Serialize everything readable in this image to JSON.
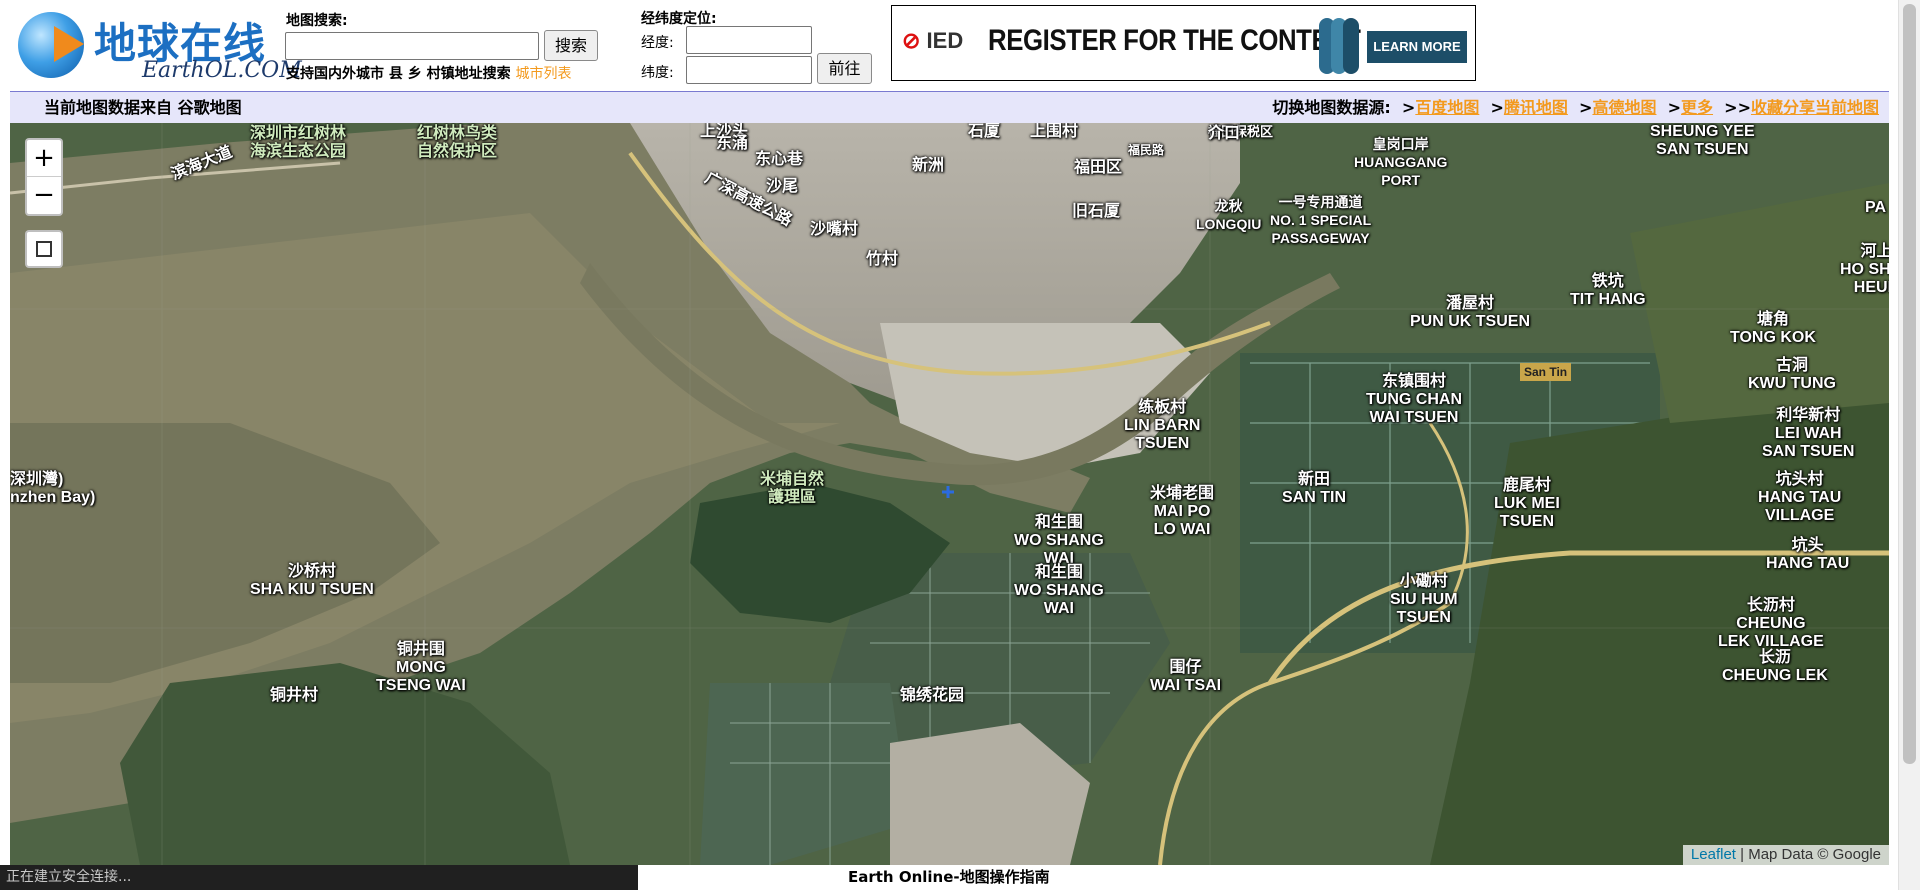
{
  "logo": {
    "cn": "地球在线",
    "en": "EarthOL.COM"
  },
  "search": {
    "label": "地图搜索:",
    "value": "",
    "button": "搜索",
    "hint": "支持国内外城市 县 乡 村镇地址搜索",
    "city_list": "城市列表"
  },
  "coords": {
    "label": "经纬度定位:",
    "lng_label": "经度:",
    "lat_label": "纬度:",
    "lng_value": "",
    "lat_value": "",
    "go_button": "前往"
  },
  "ad": {
    "brand": "IED",
    "headline": "REGISTER FOR THE CONTEST",
    "cta": "LEARN MORE",
    "colors": {
      "brand_mark": "#dd1111",
      "cta_bg": "#1d4e68",
      "logo": "#2c6b8e"
    }
  },
  "bar": {
    "source": "当前地图数据来自 谷歌地图",
    "switch_label": "切换地图数据源:",
    "links": [
      "百度地图",
      "腾讯地图",
      "高德地图",
      "更多"
    ],
    "share": "收藏分享当前地图"
  },
  "map_controls": {
    "zoom_in": "+",
    "zoom_out": "−"
  },
  "map_labels": [
    "深圳市红树林\n海滨生态公园",
    "红树林鸟类\n自然保护区",
    "滨海大道",
    "上沙头",
    "东涌",
    "东心巷",
    "沙尾",
    "新洲",
    "广深高速公路",
    "沙嘴村",
    "竹村",
    "石厦",
    "上围村",
    "福田区",
    "福田保税区",
    "福民路",
    "介口",
    "旧石厦",
    "皇岗口岸\nHUANGGANG\nPORT",
    "龙秋\nLONGQIU",
    "一号专用通道\nNO. 1 SPECIAL\nPASSAGEWAY",
    "SHEUNG YEE\nSAN TSUEN",
    "铁坑\nTIT HANG",
    "河上\nHO SHEU\nHEUN",
    "潘屋村\nPUN UK TSUEN",
    "塘角\nTONG KOK",
    "古洞\nKWU TUNG",
    "东镇围村\nTUNG CHAN\nWAI TSUEN",
    "练板村\nLIN BARN\nTSUEN",
    "利华新村\nLEI WAH\nSAN TSUEN",
    "米埔自然\n護理區",
    "新田\nSAN TIN",
    "米埔老围\nMAI PO\nLO WAI",
    "鹿尾村\nLUK MEI\nTSUEN",
    "坑头村\nHANG TAU\nVILLAGE",
    "和生围\nWO SHANG\nWAI",
    "和生围\nWO SHANG\nWAI",
    "坑头\nHANG TAU",
    "沙桥村\nSHA KIU TSUEN",
    "小磡村\nSIU HUM\nTSUEN",
    "长沥村\nCHEUNG\nLEK VILLAGE",
    "铜井围\nMONG\nTSENG WAI",
    "长沥\nCHEUNG LEK",
    "围仔\nWAI TSAI",
    "铜井村",
    "锦绣花园",
    "深圳灣)\nnzhen Bay)",
    "San Tin",
    "PA"
  ],
  "attribution": {
    "leaflet": "Leaflet",
    "text": " | Map Data © Google"
  },
  "status_text": "正在建立安全连接...",
  "footer_text": "Earth Online-地图操作指南"
}
